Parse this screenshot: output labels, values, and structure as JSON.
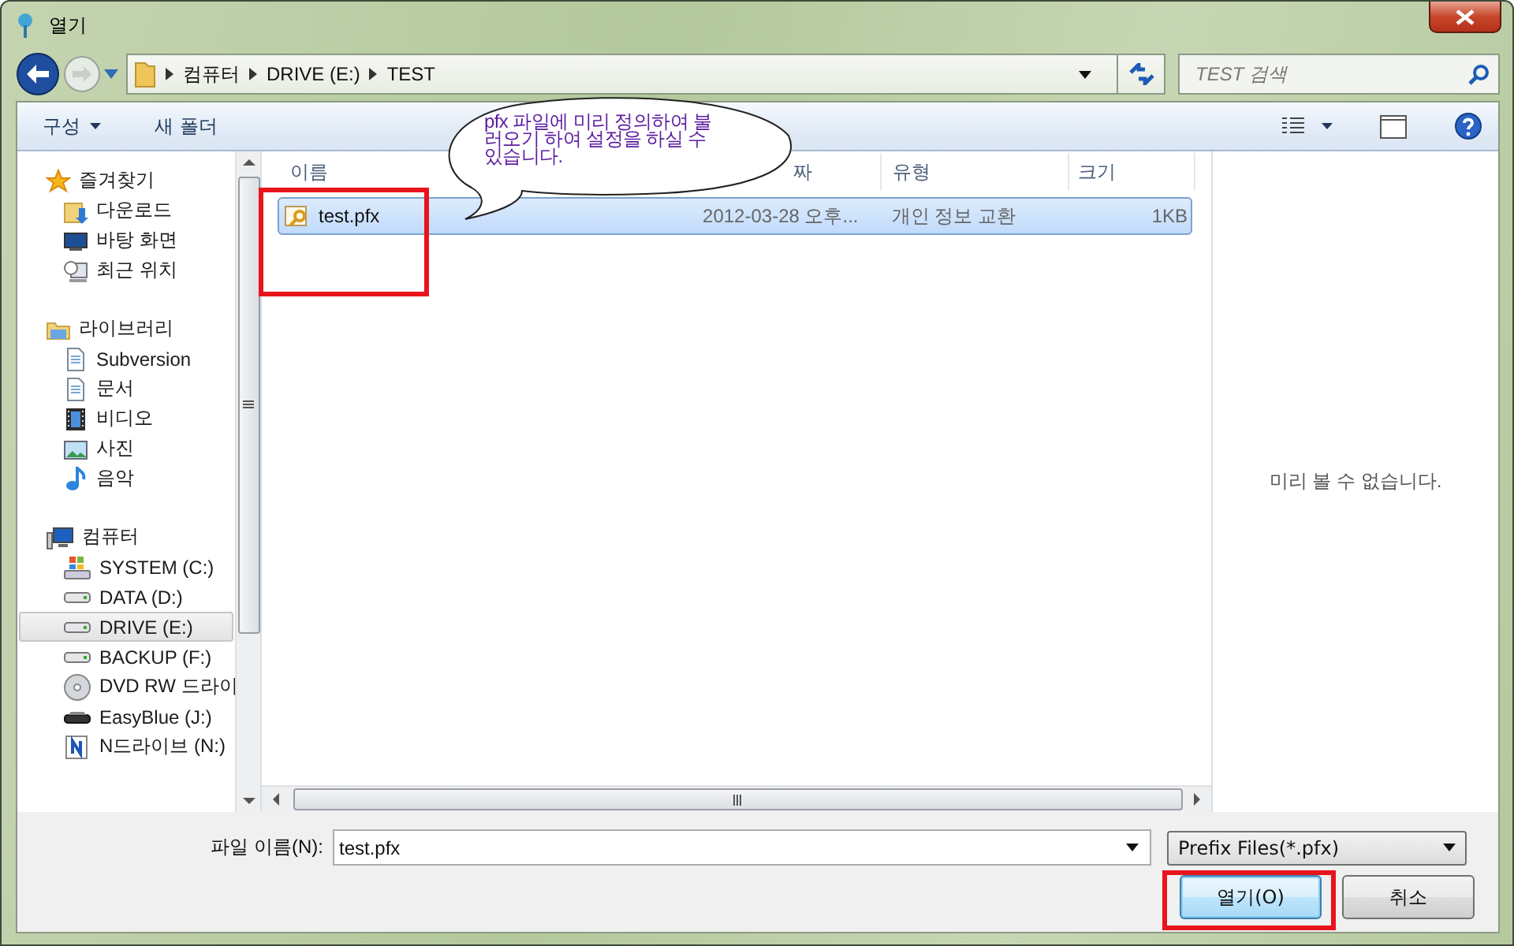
{
  "window": {
    "title": "열기"
  },
  "address": {
    "path": [
      "컴퓨터",
      "DRIVE (E:)",
      "TEST"
    ]
  },
  "search": {
    "placeholder": "TEST 검색"
  },
  "toolbar": {
    "buttons": [
      {
        "label": "구성",
        "kind": "menu"
      },
      {
        "label": "새 폴더",
        "kind": "plain"
      }
    ]
  },
  "callout": {
    "text": "pfx 파일에 미리 정의하여 불러오기 하여 설정을 하실 수 있습니다."
  },
  "sidebar": {
    "sections": [
      {
        "label": "즐겨찾기",
        "kind": "favorites",
        "selected": false,
        "children": [
          {
            "label": "다운로드",
            "kind": "downloads",
            "selected": false
          },
          {
            "label": "바탕 화면",
            "kind": "desktop",
            "selected": false
          },
          {
            "label": "최근 위치",
            "kind": "recent",
            "selected": false
          }
        ]
      },
      {
        "label": "라이브러리",
        "kind": "library",
        "selected": false,
        "children": [
          {
            "label": "Subversion",
            "kind": "document",
            "selected": false
          },
          {
            "label": "문서",
            "kind": "document",
            "selected": false
          },
          {
            "label": "비디오",
            "kind": "video",
            "selected": false
          },
          {
            "label": "사진",
            "kind": "picture",
            "selected": false
          },
          {
            "label": "음악",
            "kind": "music",
            "selected": false
          }
        ]
      },
      {
        "label": "컴퓨터",
        "kind": "computer",
        "selected": false,
        "children": [
          {
            "label": "SYSTEM (C:)",
            "kind": "system-drive",
            "selected": false
          },
          {
            "label": "DATA (D:)",
            "kind": "drive",
            "selected": false
          },
          {
            "label": "DRIVE (E:)",
            "kind": "drive",
            "selected": true
          },
          {
            "label": "BACKUP (F:)",
            "kind": "drive",
            "selected": false
          },
          {
            "label": "DVD RW 드라이",
            "kind": "dvd",
            "selected": false
          },
          {
            "label": "EasyBlue (J:)",
            "kind": "removable",
            "selected": false
          },
          {
            "label": "N드라이브 (N:)",
            "kind": "network-drive",
            "selected": false
          }
        ]
      }
    ]
  },
  "table": {
    "columns": [
      "이름",
      "짜",
      "유형",
      "크기"
    ],
    "rows": [
      {
        "cells": [
          "test.pfx",
          "2012-03-28 오후...",
          "개인 정보 교환",
          "1KB"
        ],
        "selected": true,
        "highlighted": true
      }
    ]
  },
  "preview": {
    "message": "미리 볼 수 없습니다."
  },
  "filename": {
    "label": "파일 이름(N):",
    "value": "test.pfx"
  },
  "filetype": {
    "value": "Prefix Files(*.pfx)"
  },
  "buttons": [
    {
      "label": "열기(O)",
      "kind": "primary",
      "highlighted": true
    },
    {
      "label": "취소",
      "kind": "normal",
      "highlighted": false
    }
  ]
}
